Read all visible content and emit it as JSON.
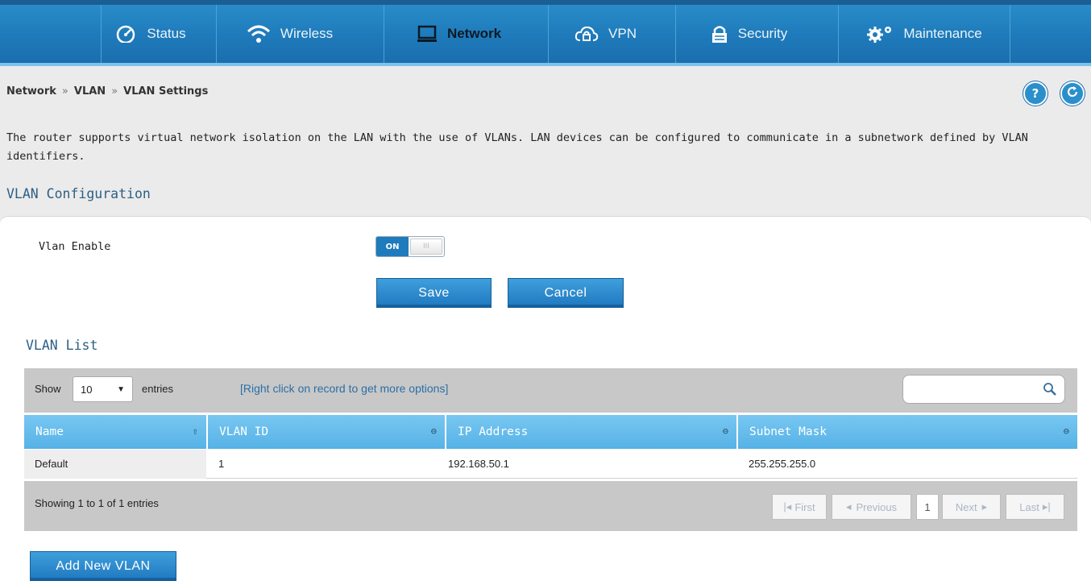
{
  "nav": [
    {
      "label": "Status",
      "icon": "speedometer-icon",
      "active": false
    },
    {
      "label": "Wireless",
      "icon": "wifi-icon",
      "active": false
    },
    {
      "label": "Network",
      "icon": "monitor-icon",
      "active": true
    },
    {
      "label": "VPN",
      "icon": "cloud-lock-icon",
      "active": false
    },
    {
      "label": "Security",
      "icon": "lock-icon",
      "active": false
    },
    {
      "label": "Maintenance",
      "icon": "gears-icon",
      "active": false
    }
  ],
  "breadcrumb": [
    "Network",
    "VLAN",
    "VLAN Settings"
  ],
  "breadcrumb_sep": "»",
  "help_icon": "?",
  "description": "The router supports virtual network isolation on the LAN with the use of VLANs. LAN devices can be configured to communicate in a subnetwork defined by VLAN identifiers.",
  "section_title": "VLAN Configuration",
  "vlan_enable": {
    "label": "Vlan Enable",
    "state": "ON",
    "grip": "III"
  },
  "buttons": {
    "save": "Save",
    "cancel": "Cancel",
    "add": "Add New VLAN"
  },
  "list_title": "VLAN List",
  "table": {
    "show_label": "Show",
    "show_value": "10",
    "entries_label": "entries",
    "hint": "[Right click on record to get more options]",
    "columns": [
      "Name",
      "VLAN ID",
      "IP Address",
      "Subnet Mask"
    ],
    "rows": [
      {
        "name": "Default",
        "vlan_id": "1",
        "ip": "192.168.50.1",
        "mask": "255.255.255.0"
      }
    ],
    "showing": "Showing 1 to 1 of 1 entries",
    "pager": {
      "first": "First",
      "previous": "Previous",
      "page": "1",
      "next": "Next",
      "last": "Last"
    }
  },
  "colors": {
    "nav_blue": "#1f7bbb",
    "header_blue": "#56b2e6",
    "title_blue": "#2c5f86"
  }
}
